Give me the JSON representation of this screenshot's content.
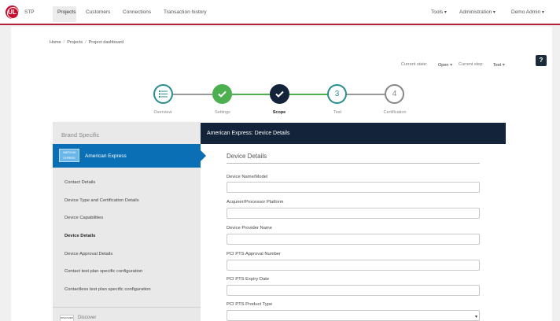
{
  "nav": {
    "logo": "UL",
    "app": "STP",
    "links": [
      "Projects",
      "Customers",
      "Connections",
      "Transaction history"
    ],
    "right": [
      "Tools",
      "Administration",
      "Demo Admin"
    ]
  },
  "breadcrumb": [
    "Home",
    "Projects",
    "Project dashboard"
  ],
  "help_label": "?",
  "state": {
    "current_state_label": "Current state:",
    "current_state_value": "Open",
    "current_step_label": "Current step:",
    "current_step_value": "Test"
  },
  "stepper": {
    "steps": [
      {
        "label": "Overview",
        "icon": "list-icon",
        "status": "overview"
      },
      {
        "label": "Settings",
        "icon": "check-icon",
        "status": "done"
      },
      {
        "label": "Scope",
        "icon": "check-icon",
        "status": "current"
      },
      {
        "label": "Test",
        "number": "3",
        "status": "next"
      },
      {
        "label": "Certification",
        "number": "4",
        "status": "todo"
      }
    ]
  },
  "left": {
    "header": "Brand Specific",
    "selected_brand": {
      "name": "American Express",
      "logo_text": "AMERICAN EXPRESS"
    },
    "items": [
      "Contact Details",
      "Device Type and Certification Details",
      "Device Capabilities",
      "Device Details",
      "Device Approval Details",
      "Contact test plan specific configuration",
      "Contactless test plan specific configuration"
    ],
    "active_item": "Device Details",
    "next_brand": {
      "name": "Discover",
      "logo_text": "DISCOVER"
    }
  },
  "form": {
    "header": "American Express: Device Details",
    "section_title": "Device Details",
    "fields": [
      {
        "label": "Device Name/Model",
        "value": ""
      },
      {
        "label": "Acquirer/Processor Platform",
        "value": ""
      },
      {
        "label": "Device Provider Name",
        "value": ""
      },
      {
        "label": "PCI PTS Approval Number",
        "value": ""
      },
      {
        "label": "PCI PTS Expiry Date",
        "value": ""
      },
      {
        "label": "PCI PTS Product Type",
        "value": ""
      }
    ]
  },
  "colors": {
    "brand_red": "#c8102e",
    "teal": "#2a8e8e",
    "green": "#4caf50",
    "navy": "#12233a",
    "selected_blue": "#0b6fb5"
  }
}
